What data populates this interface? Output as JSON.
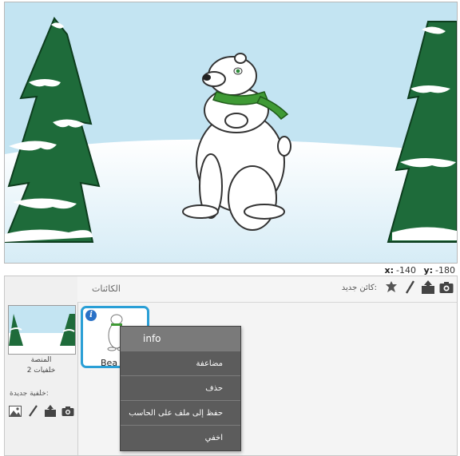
{
  "stage": {
    "coords": {
      "x_label": "x:",
      "x_value": "-140",
      "y_label": "y:",
      "y_value": "-180"
    }
  },
  "sprites_panel": {
    "title": "الكائنات",
    "new_sprite_label": "كائن جديد:",
    "new_sprite_tools": [
      "sprite-library-icon",
      "paint-brush-icon",
      "upload-icon",
      "camera-icon"
    ]
  },
  "stage_panel": {
    "name": "المنصة",
    "backdrop_count": "خلفيات 2",
    "new_backdrop_label": "خلفية جديدة:",
    "new_backdrop_tools": [
      "landscape-icon",
      "paint-brush-icon",
      "upload-icon",
      "camera-icon"
    ]
  },
  "sprite": {
    "name": "Bea",
    "info_badge": "i",
    "selected_color": "#2a9fd6"
  },
  "context_menu": {
    "items": [
      "info",
      "مضاعفة",
      "حذف",
      "حفظ إلى ملف على الحاسب",
      "اخفي"
    ]
  },
  "colors": {
    "sky": "#c3e4f2",
    "snow": "#ffffff",
    "tree": "#1e6b3a",
    "scarf": "#3f9a35",
    "menu_bg": "#5c5c5c"
  }
}
